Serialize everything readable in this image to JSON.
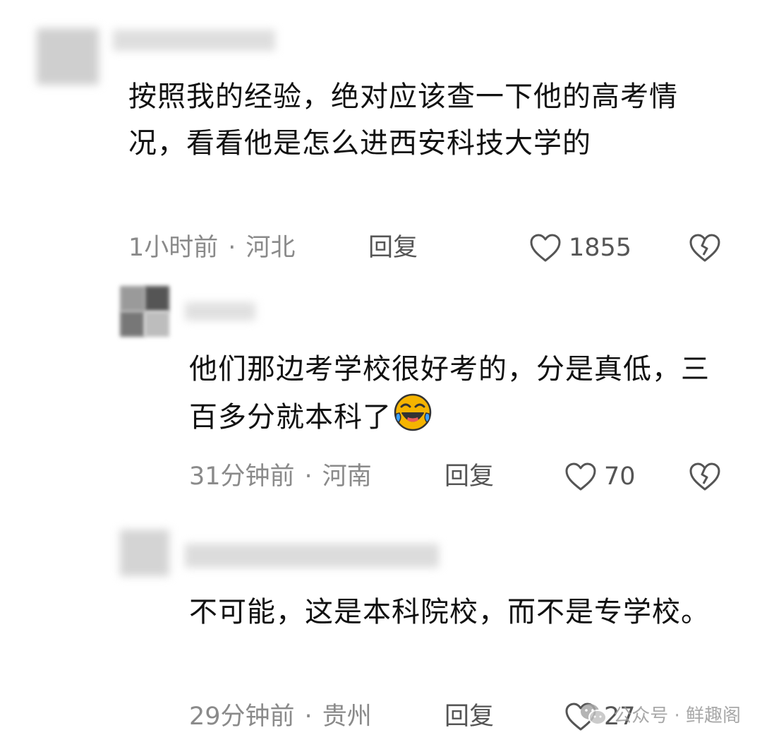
{
  "comments": [
    {
      "text": "按照我的经验，绝对应该查一下他的高考情况，看看他是怎么进西安科技大学的",
      "time": "1小时前",
      "location": "河北",
      "reply_label": "回复",
      "likes": "1855",
      "emoji": "",
      "is_reply": false
    },
    {
      "text": "他们那边考学校很好考的，分是真低，三百多分就本科了",
      "time": "31分钟前",
      "location": "河南",
      "reply_label": "回复",
      "likes": "70",
      "emoji": "laugh-cry-emoji",
      "is_reply": true
    },
    {
      "text": "不可能，这是本科院校，而不是专学校。",
      "time": "29分钟前",
      "location": "贵州",
      "reply_label": "回复",
      "likes": "27",
      "emoji": "",
      "is_reply": true
    }
  ],
  "separator": "·",
  "icons": {
    "like": "heart-outline-icon",
    "dislike": "broken-heart-icon",
    "watermark": "wechat-icon"
  },
  "watermark": {
    "text": "公众号 · 鲜趣阁"
  },
  "colors": {
    "text": "#111111",
    "meta": "#8a8a8a",
    "action": "#555555",
    "emoji_face": "#f5b400"
  }
}
